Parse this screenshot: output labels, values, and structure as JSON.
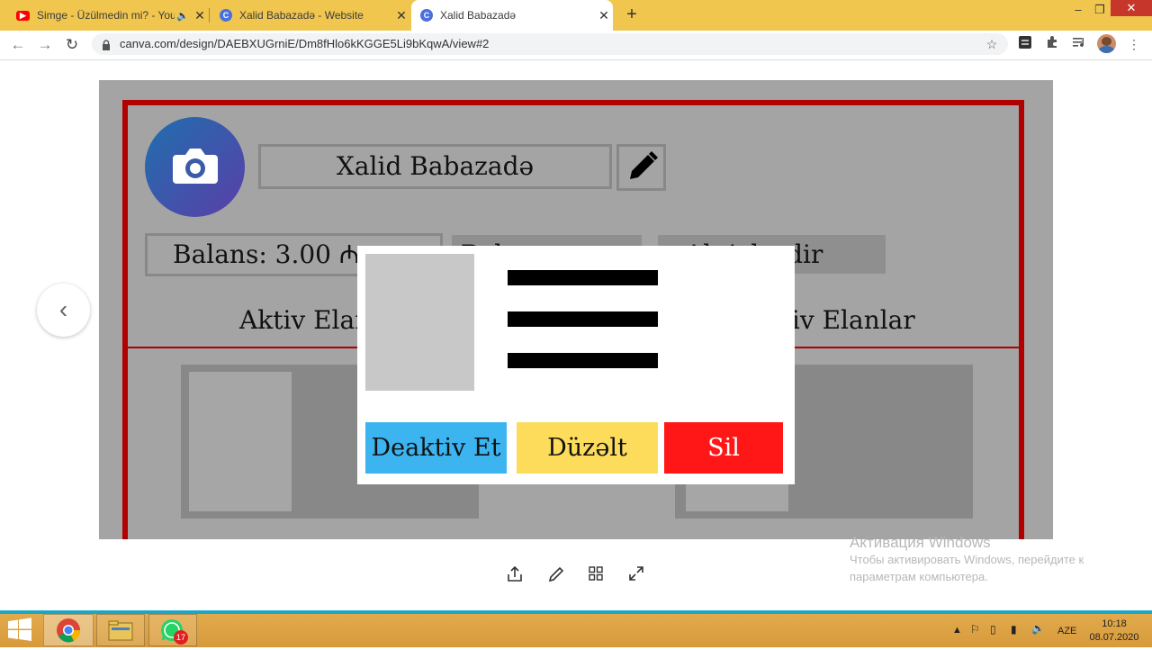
{
  "browser": {
    "tabs": [
      {
        "title": "Simge - Üzülmedin mi? - You",
        "favicon": "youtube-icon",
        "audio": true
      },
      {
        "title": "Xalid Babazadə - Website",
        "favicon": "canva-icon"
      },
      {
        "title": "Xalid Babazadə",
        "favicon": "canva-icon",
        "active": true
      }
    ],
    "url": "canva.com/design/DAEBXUGrniE/Dm8fHlo6kKGGE5Li9bKqwA/view#2",
    "colors": {
      "tabstrip": "#f0c64f",
      "taskbar_accent": "#1aa7c7"
    }
  },
  "design": {
    "profile_name": "Xalid Babazadə",
    "balance_text": "Balans:  3.00 ₼",
    "button2_text": "Balansı ar",
    "button3_text": "Aktivləşdir",
    "heading_left": "Aktiv Elanlar",
    "heading_right": "Deaktiv Elanlar",
    "colors": {
      "frame": "#b00000",
      "avatar_start": "#1f6fae",
      "avatar_end": "#5b3ea8"
    }
  },
  "modal": {
    "buttons": [
      {
        "label": "Deaktiv Et",
        "color": "#3cb4f0"
      },
      {
        "label": "Düzəlt",
        "color": "#fddc5c"
      },
      {
        "label": "Sil",
        "color": "#ff1616"
      }
    ]
  },
  "watermark": {
    "title": "Активация Windows",
    "line1": "Чтобы активировать Windows, перейдите к",
    "line2": "параметрам компьютера."
  },
  "taskbar": {
    "lang": "AZE",
    "time": "10:18",
    "date": "08.07.2020",
    "whatsapp_badge": "17"
  }
}
